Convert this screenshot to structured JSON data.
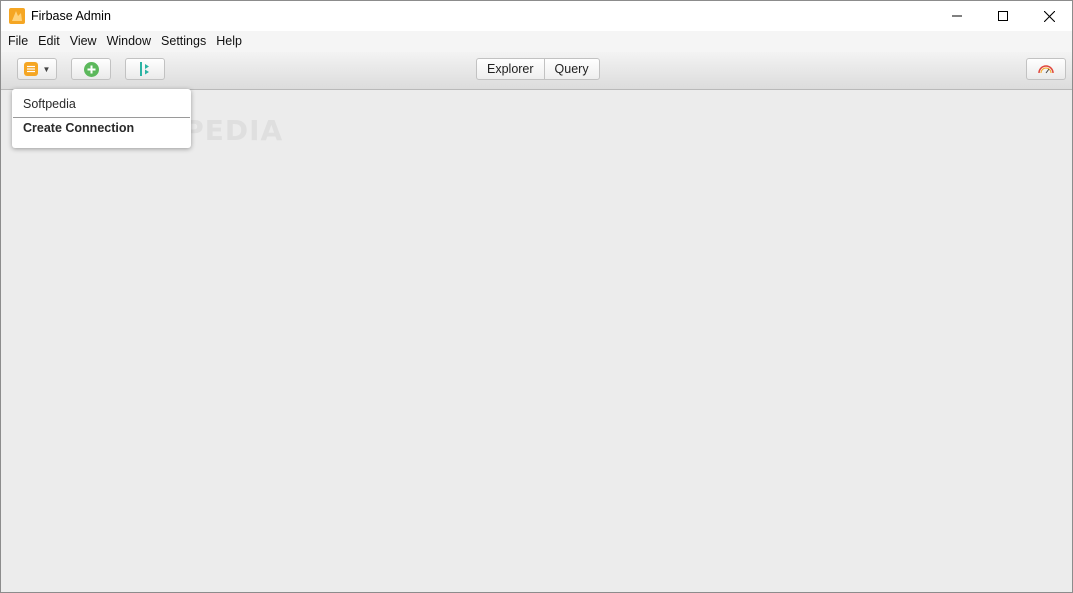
{
  "window": {
    "title": "Firbase Admin",
    "controls": [
      "minimize-icon",
      "maximize-icon",
      "close-icon"
    ]
  },
  "menubar": {
    "items": [
      "File",
      "Edit",
      "View",
      "Window",
      "Settings",
      "Help"
    ]
  },
  "toolbar": {
    "connection_icon": "database-icon",
    "connection_arrow": "▼",
    "add_icon": "add-circle-icon",
    "export_icon": "export-icon",
    "tabs": [
      "Explorer",
      "Query"
    ],
    "right_icon": "speedometer-icon",
    "colors": {
      "accent_orange": "#f5a623",
      "add_green": "#5cb85c",
      "export_teal": "#2bb3a3"
    }
  },
  "connection_menu": {
    "items": [
      "Softpedia",
      "Create Connection"
    ]
  },
  "watermark": "SOFTPEDIA"
}
